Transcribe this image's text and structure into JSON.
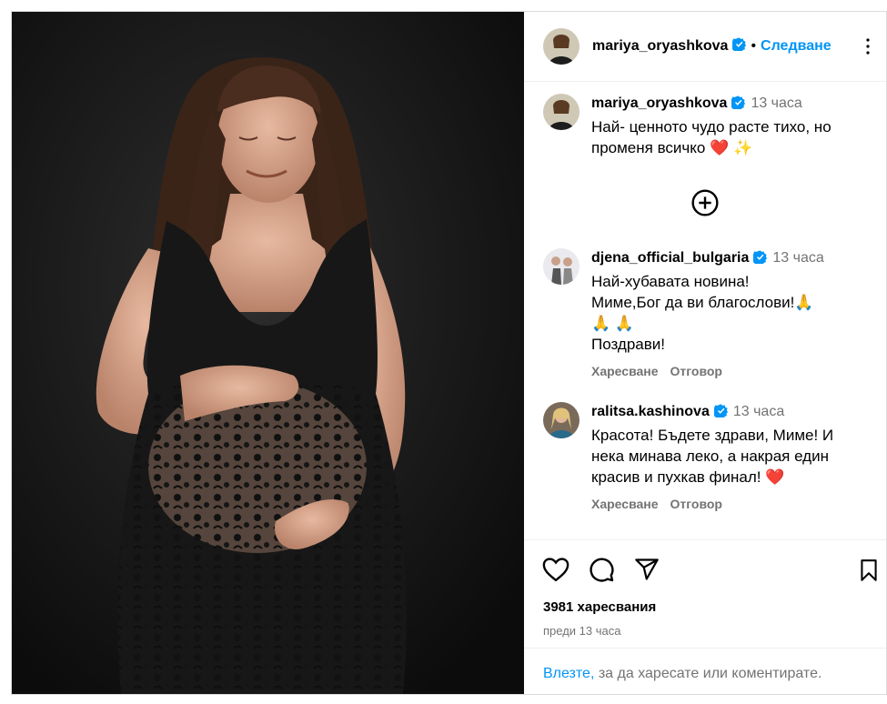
{
  "post": {
    "username": "mariya_oryashkova",
    "follow_label": "Следване",
    "separator": "•",
    "photo_icon": "pregnant-woman-black-lace-dress-photo"
  },
  "comments": [
    {
      "username": "mariya_oryashkova",
      "time": "13 часа",
      "text": "Най- ценното чудо расте тихо, но променя всичко ❤️ ✨"
    },
    {
      "username": "djena_official_bulgaria",
      "time": "13 часа",
      "text_lines": [
        "Най-хубавата новина!",
        "Миме,Бог да ви благослови!🙏",
        "🙏 🙏",
        "Поздрави!"
      ],
      "like_label": "Харесване",
      "reply_label": "Отговор"
    },
    {
      "username": "ralitsa.kashinova",
      "time": "13 часа",
      "text": "Красота! Бъдете здрави, Миме! И нека минава леко, а накрая един красив и пухкав финал! ❤️",
      "like_label": "Харесване",
      "reply_label": "Отговор"
    }
  ],
  "stats": {
    "likes": "3981 харесвания",
    "ago": "преди 13 часа"
  },
  "login": {
    "link": "Влезте,",
    "rest": " за да харесате или коментирате."
  },
  "colors": {
    "accent": "#0095f6",
    "verified": "#0095f6",
    "muted": "#737373",
    "heart": "#ed4956"
  }
}
